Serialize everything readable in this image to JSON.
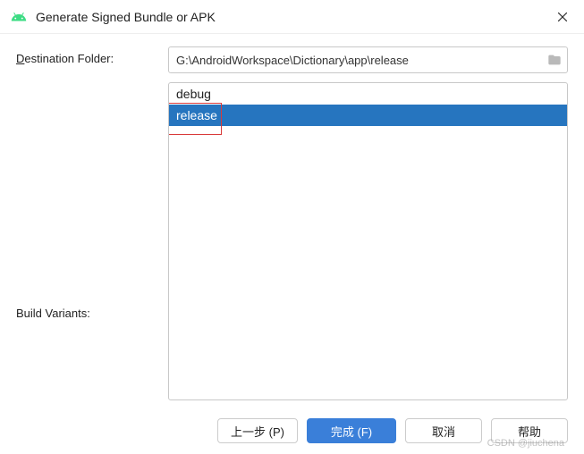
{
  "window": {
    "title": "Generate Signed Bundle or APK"
  },
  "labels": {
    "destination_pre": "D",
    "destination_post": "estination Folder:",
    "build_pre": "B",
    "build_post": "uild Variants:"
  },
  "destination": {
    "path": "G:\\AndroidWorkspace\\Dictionary\\app\\release"
  },
  "variants": {
    "items": [
      {
        "label": "debug",
        "selected": false
      },
      {
        "label": "release",
        "selected": true
      }
    ]
  },
  "buttons": {
    "previous": "上一步 (P)",
    "finish": "完成 (F)",
    "cancel": "取消",
    "help": "帮助"
  },
  "watermark": "CSDN @jiuchena"
}
